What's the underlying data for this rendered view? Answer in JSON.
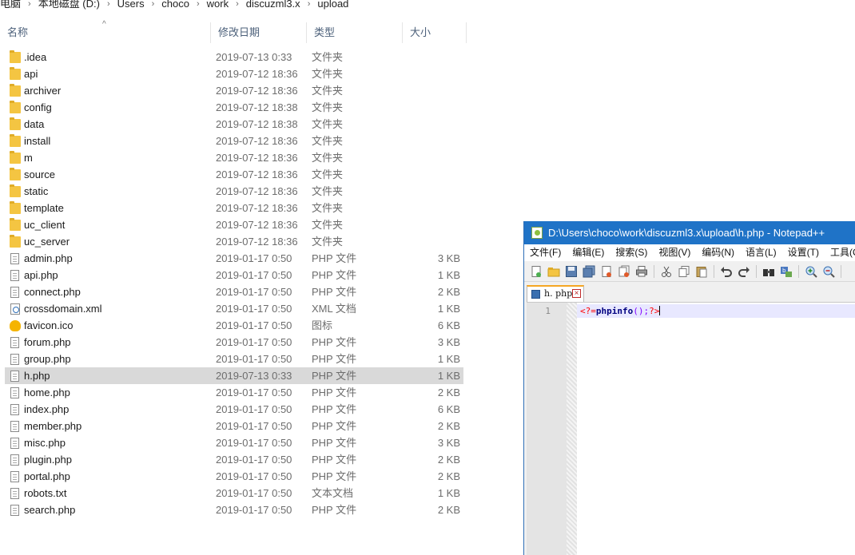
{
  "breadcrumb": [
    "电脑",
    "本地磁盘 (D:)",
    "Users",
    "choco",
    "work",
    "discuzml3.x",
    "upload"
  ],
  "columns": {
    "name": "名称",
    "date": "修改日期",
    "type": "类型",
    "size": "大小"
  },
  "files": [
    {
      "name": ".idea",
      "date": "2019-07-13 0:33",
      "type": "文件夹",
      "size": "",
      "kind": "folder"
    },
    {
      "name": "api",
      "date": "2019-07-12 18:36",
      "type": "文件夹",
      "size": "",
      "kind": "folder"
    },
    {
      "name": "archiver",
      "date": "2019-07-12 18:36",
      "type": "文件夹",
      "size": "",
      "kind": "folder"
    },
    {
      "name": "config",
      "date": "2019-07-12 18:38",
      "type": "文件夹",
      "size": "",
      "kind": "folder"
    },
    {
      "name": "data",
      "date": "2019-07-12 18:38",
      "type": "文件夹",
      "size": "",
      "kind": "folder"
    },
    {
      "name": "install",
      "date": "2019-07-12 18:36",
      "type": "文件夹",
      "size": "",
      "kind": "folder"
    },
    {
      "name": "m",
      "date": "2019-07-12 18:36",
      "type": "文件夹",
      "size": "",
      "kind": "folder"
    },
    {
      "name": "source",
      "date": "2019-07-12 18:36",
      "type": "文件夹",
      "size": "",
      "kind": "folder"
    },
    {
      "name": "static",
      "date": "2019-07-12 18:36",
      "type": "文件夹",
      "size": "",
      "kind": "folder"
    },
    {
      "name": "template",
      "date": "2019-07-12 18:36",
      "type": "文件夹",
      "size": "",
      "kind": "folder"
    },
    {
      "name": "uc_client",
      "date": "2019-07-12 18:36",
      "type": "文件夹",
      "size": "",
      "kind": "folder"
    },
    {
      "name": "uc_server",
      "date": "2019-07-12 18:36",
      "type": "文件夹",
      "size": "",
      "kind": "folder"
    },
    {
      "name": "admin.php",
      "date": "2019-01-17 0:50",
      "type": "PHP 文件",
      "size": "3 KB",
      "kind": "file"
    },
    {
      "name": "api.php",
      "date": "2019-01-17 0:50",
      "type": "PHP 文件",
      "size": "1 KB",
      "kind": "file"
    },
    {
      "name": "connect.php",
      "date": "2019-01-17 0:50",
      "type": "PHP 文件",
      "size": "2 KB",
      "kind": "file"
    },
    {
      "name": "crossdomain.xml",
      "date": "2019-01-17 0:50",
      "type": "XML 文档",
      "size": "1 KB",
      "kind": "xml"
    },
    {
      "name": "favicon.ico",
      "date": "2019-01-17 0:50",
      "type": "图标",
      "size": "6 KB",
      "kind": "favicon"
    },
    {
      "name": "forum.php",
      "date": "2019-01-17 0:50",
      "type": "PHP 文件",
      "size": "3 KB",
      "kind": "file"
    },
    {
      "name": "group.php",
      "date": "2019-01-17 0:50",
      "type": "PHP 文件",
      "size": "1 KB",
      "kind": "file"
    },
    {
      "name": "h.php",
      "date": "2019-07-13 0:33",
      "type": "PHP 文件",
      "size": "1 KB",
      "kind": "file",
      "selected": true
    },
    {
      "name": "home.php",
      "date": "2019-01-17 0:50",
      "type": "PHP 文件",
      "size": "2 KB",
      "kind": "file"
    },
    {
      "name": "index.php",
      "date": "2019-01-17 0:50",
      "type": "PHP 文件",
      "size": "6 KB",
      "kind": "file"
    },
    {
      "name": "member.php",
      "date": "2019-01-17 0:50",
      "type": "PHP 文件",
      "size": "2 KB",
      "kind": "file"
    },
    {
      "name": "misc.php",
      "date": "2019-01-17 0:50",
      "type": "PHP 文件",
      "size": "3 KB",
      "kind": "file"
    },
    {
      "name": "plugin.php",
      "date": "2019-01-17 0:50",
      "type": "PHP 文件",
      "size": "2 KB",
      "kind": "file"
    },
    {
      "name": "portal.php",
      "date": "2019-01-17 0:50",
      "type": "PHP 文件",
      "size": "2 KB",
      "kind": "file"
    },
    {
      "name": "robots.txt",
      "date": "2019-01-17 0:50",
      "type": "文本文档",
      "size": "1 KB",
      "kind": "file"
    },
    {
      "name": "search.php",
      "date": "2019-01-17 0:50",
      "type": "PHP 文件",
      "size": "2 KB",
      "kind": "file"
    }
  ],
  "notepad": {
    "title": "D:\\Users\\choco\\work\\discuzml3.x\\upload\\h.php - Notepad++",
    "menu": [
      "文件(F)",
      "编辑(E)",
      "搜索(S)",
      "视图(V)",
      "编码(N)",
      "语言(L)",
      "设置(T)",
      "工具(O)"
    ],
    "tab_label": "h. php",
    "line_number": "1",
    "code": {
      "open": "<?=",
      "fn": "phpinfo",
      "args": "();",
      "close": "?>"
    }
  }
}
